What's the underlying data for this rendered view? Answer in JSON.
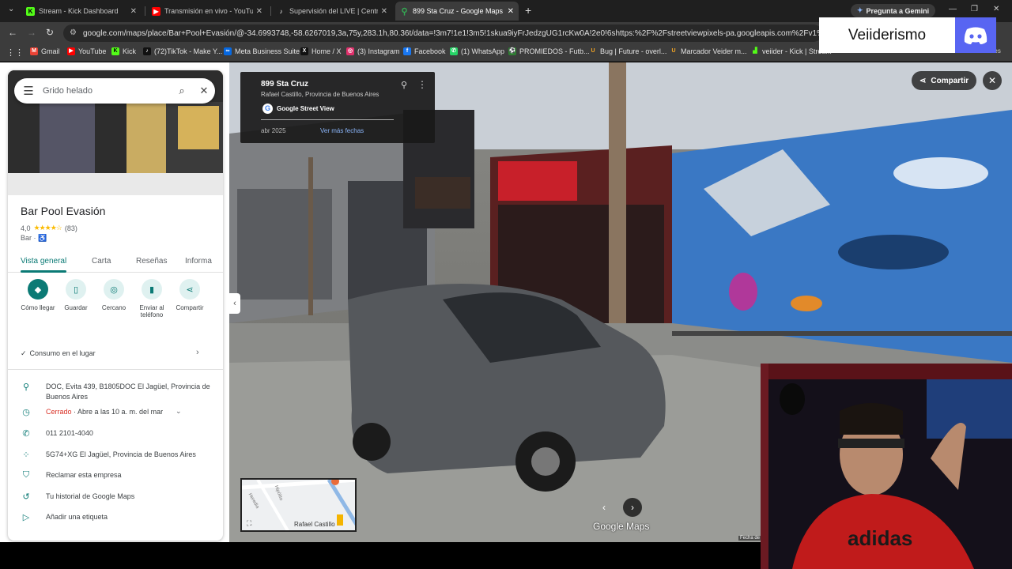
{
  "browser": {
    "tabs": [
      {
        "title": "Stream - Kick Dashboard",
        "icon": "kick-icon",
        "color": "#53fc18",
        "active": false
      },
      {
        "title": "Transmisión en vivo - YouTube",
        "icon": "youtube-icon",
        "color": "#ff0000",
        "active": false
      },
      {
        "title": "Supervisión del LIVE | Centro LI",
        "icon": "tiktok-icon",
        "color": "#ffffff",
        "active": false
      },
      {
        "title": "899 Sta Cruz - Google Maps",
        "icon": "google-maps-icon",
        "color": "#34a853",
        "active": true
      }
    ],
    "gemini_label": "Pregunta a Gemini",
    "url": "google.com/maps/place/Bar+Pool+Evasión/@-34.6993748,-58.6267019,3a,75y,283.1h,80.36t/data=!3m7!1e1!3m5!1skua9iyFrJedzgUG1rcKw0A!2e0!6shttps:%2F%2Fstreetviewpixels-pa.googleapis.com%2Fv1%2Fthumbnail%3Fcb",
    "bookmarks": [
      {
        "label": "Gmail",
        "color": "#ea4335"
      },
      {
        "label": "YouTube",
        "color": "#ff0000"
      },
      {
        "label": "Kick",
        "color": "#53fc18"
      },
      {
        "label": "(72)TikTok - Make Y...",
        "color": "#111111"
      },
      {
        "label": "Meta Business Suite",
        "color": "#0668e1"
      },
      {
        "label": "Home / X",
        "color": "#111111"
      },
      {
        "label": "(3) Instagram",
        "color": "#e1306c"
      },
      {
        "label": "Facebook",
        "color": "#1877f2"
      },
      {
        "label": "(1) WhatsApp",
        "color": "#25d366"
      },
      {
        "label": "PROMIEDOS - Futb...",
        "color": "#2e7d32"
      },
      {
        "label": "Bug | Future - overl...",
        "color": "#f5a623"
      },
      {
        "label": "Marcador Veider m...",
        "color": "#f5a623"
      },
      {
        "label": "veiider - Kick | Strea...",
        "color": "#53fc18"
      }
    ],
    "bookmarks_all": "Todos los marcadores"
  },
  "overlay": {
    "name": "Veiiderismo"
  },
  "panel": {
    "search_value": "Grido helado",
    "place_name": "Bar Pool Evasión",
    "rating": "4,0",
    "stars": "★★★★☆",
    "reviews": "(83)",
    "category": "Bar ·",
    "tabs": [
      "Vista general",
      "Carta",
      "Reseñas",
      "Informa"
    ],
    "actions": [
      {
        "label": "Cómo llegar",
        "icon": "directions-icon"
      },
      {
        "label": "Guardar",
        "icon": "bookmark-icon"
      },
      {
        "label": "Cercano",
        "icon": "nearby-icon"
      },
      {
        "label": "Enviar al teléfono",
        "icon": "send-to-phone-icon"
      },
      {
        "label": "Compartir",
        "icon": "share-icon"
      }
    ],
    "consumo": "Consumo en el lugar",
    "address": "DOC, Evita 439, B1805DOC El Jagüel, Provincia de Buenos Aires",
    "hours_status": "Cerrado",
    "hours_rest": " · Abre a las 10 a. m. del mar",
    "phone": "011 2101-4040",
    "plus_code": "5G74+XG El Jagüel, Provincia de Buenos Aires",
    "claim": "Reclamar esta empresa",
    "history": "Tu historial de Google Maps",
    "label": "Añadir una etiqueta"
  },
  "streetview": {
    "title": "899 Sta Cruz",
    "subtitle": "Rafael Castillo, Provincia de Buenos Aires",
    "source": "Google Street View",
    "date": "abr 2025",
    "more_dates": "Ver más fechas",
    "share_label": "Compartir",
    "watermark": "Google Maps",
    "date_footer": "Fecha de",
    "minimap_label": "Rafael Castillo",
    "minimap_street1": "Heredia",
    "minimap_street2": "Hipólito"
  }
}
